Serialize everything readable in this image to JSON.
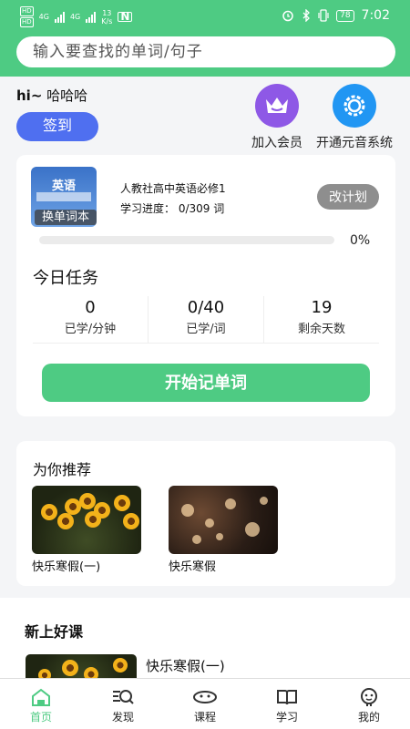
{
  "status": {
    "left_tag_top": "HD",
    "left_tag_bottom": "HD",
    "net1": "4G",
    "net2": "4G",
    "speed_num": "13",
    "speed_unit": "K/s",
    "nfc": "N",
    "battery": "78",
    "time": "7:02"
  },
  "search": {
    "placeholder": "输入要查找的单词/句子"
  },
  "greeting": {
    "prefix": "hi~",
    "name": "哈哈哈"
  },
  "signin_label": "签到",
  "actions": {
    "vip_label": "加入会员",
    "vowel_label": "开通元音系统"
  },
  "plan": {
    "book_cover_text": "英语",
    "change_book_label": "换单词本",
    "book_title": "人教社高中英语必修1",
    "progress_label": "学习进度：",
    "progress_value": "0/309 词",
    "edit_plan_label": "改计划",
    "progress_percent": "0%",
    "progress_fraction": 0
  },
  "tasks": {
    "title": "今日任务",
    "stats": [
      {
        "value": "0",
        "label": "已学/分钟"
      },
      {
        "value": "0/40",
        "label": "已学/词"
      },
      {
        "value": "19",
        "label": "剩余天数"
      }
    ],
    "start_label": "开始记单词"
  },
  "recommend": {
    "title": "为你推荐",
    "items": [
      {
        "caption": "快乐寒假(一)"
      },
      {
        "caption": "快乐寒假"
      }
    ]
  },
  "new_courses": {
    "title": "新上好课",
    "items": [
      {
        "name": "快乐寒假(一)"
      }
    ]
  },
  "tabs": [
    {
      "label": "首页",
      "icon": "home-icon",
      "active": true
    },
    {
      "label": "发现",
      "icon": "discover-icon",
      "active": false
    },
    {
      "label": "课程",
      "icon": "course-icon",
      "active": false
    },
    {
      "label": "学习",
      "icon": "study-icon",
      "active": false
    },
    {
      "label": "我的",
      "icon": "profile-icon",
      "active": false
    }
  ],
  "colors": {
    "primary": "#4ecb83",
    "signin": "#4f6ff0",
    "vip": "#8e58e6",
    "vowel": "#2196f3",
    "edit_plan": "#8e8e8e"
  }
}
